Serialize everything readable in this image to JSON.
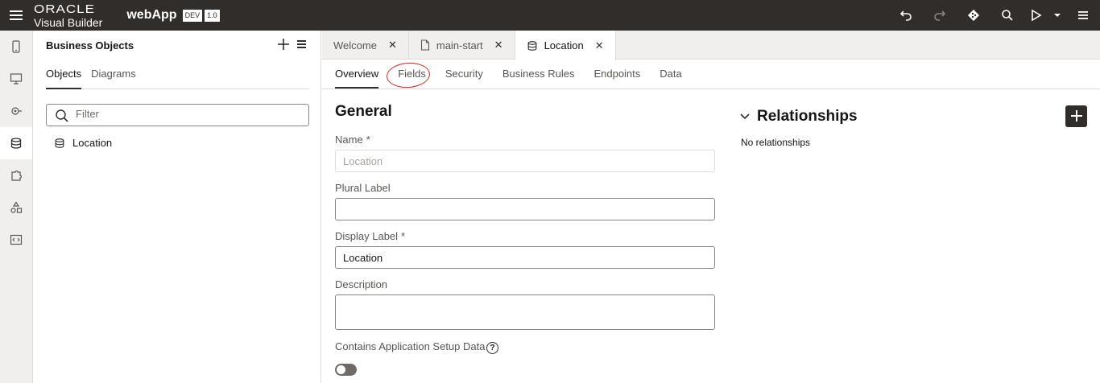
{
  "header": {
    "brand_top": "ORACLE",
    "brand_bottom": "Visual Builder",
    "app_name": "webApp",
    "env_badge": "DEV",
    "version_badge": "1.0"
  },
  "rail": {
    "items": [
      "mobile-apps",
      "web-apps",
      "services",
      "business-objects",
      "components",
      "processes",
      "source-view"
    ]
  },
  "panel": {
    "title": "Business Objects",
    "tabs": [
      {
        "label": "Objects"
      },
      {
        "label": "Diagrams"
      }
    ],
    "filter_placeholder": "Filter",
    "items": [
      {
        "label": "Location"
      }
    ]
  },
  "editor_tabs": [
    {
      "label": "Welcome"
    },
    {
      "label": "main-start"
    },
    {
      "label": "Location"
    }
  ],
  "page_tabs": [
    {
      "label": "Overview"
    },
    {
      "label": "Fields"
    },
    {
      "label": "Security"
    },
    {
      "label": "Business Rules"
    },
    {
      "label": "Endpoints"
    },
    {
      "label": "Data"
    }
  ],
  "general": {
    "title": "General",
    "name_label": "Name",
    "name_value": "Location",
    "plural_label": "Plural Label",
    "plural_value": "",
    "display_label": "Display Label",
    "display_value": "Location",
    "description_label": "Description",
    "description_value": "",
    "setup_label": "Contains Application Setup Data",
    "required_mark": "*",
    "help_glyph": "?"
  },
  "relationships": {
    "title": "Relationships",
    "empty_text": "No relationships"
  },
  "colors": {
    "header_bg": "#312d2a",
    "annotation_red": "#e02020"
  }
}
